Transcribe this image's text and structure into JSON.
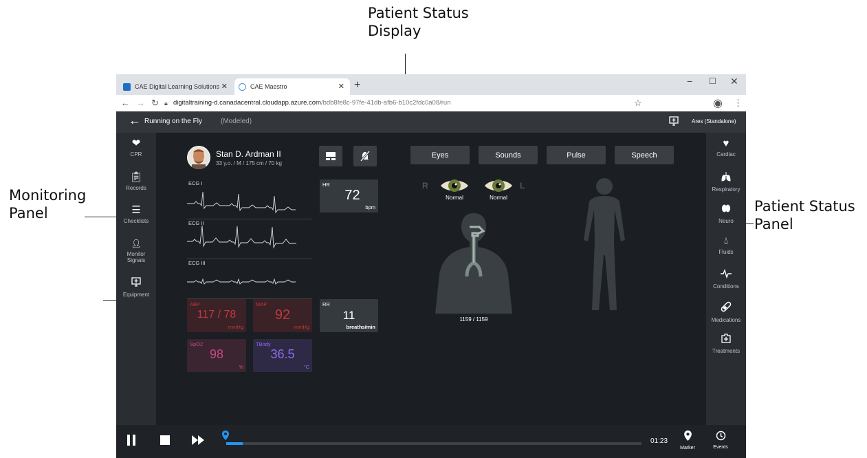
{
  "annotations": {
    "patient_status_display": "Patient Status\nDisplay",
    "monitoring_panel": "Monitoring\nPanel",
    "patient_status_panel": "Patient Status\nPanel"
  },
  "browser": {
    "tabs": [
      {
        "title": "CAE Digital Learning Solutions",
        "icon": "cae-icon"
      },
      {
        "title": "CAE Maestro",
        "icon": "maestro-icon"
      }
    ],
    "url_host": "digitaltraining-d.canadacentral.cloudapp.azure.com",
    "url_path": "/bdb8fe8c-97fe-41db-afb6-b10c2fdc0a08/run"
  },
  "app": {
    "scenario_title": "Running on the Fly",
    "scenario_mode": "(Modeled)",
    "simulator": "Ares (Standalone)"
  },
  "left_nav": [
    {
      "label": "CPR",
      "icon": "heart-pulse-icon"
    },
    {
      "label": "Records",
      "icon": "clipboard-icon"
    },
    {
      "label": "Checklists",
      "icon": "checklist-icon"
    },
    {
      "label": "Monitor\nSignals",
      "icon": "monitor-signals-icon"
    },
    {
      "label": "Equipment",
      "icon": "monitor-icon"
    }
  ],
  "right_nav": [
    {
      "label": "Cardiac",
      "icon": "heart-icon"
    },
    {
      "label": "Respiratory",
      "icon": "lungs-icon"
    },
    {
      "label": "Neuro",
      "icon": "brain-icon"
    },
    {
      "label": "Fluids",
      "icon": "drop-icon"
    },
    {
      "label": "Conditions",
      "icon": "pulse-icon"
    },
    {
      "label": "Medications",
      "icon": "pill-icon"
    },
    {
      "label": "Treatments",
      "icon": "medkit-icon"
    }
  ],
  "patient": {
    "name": "Stan D. Ardman II",
    "details": "33 y.o. / M / 175 cm / 70 kg"
  },
  "ecg": [
    "ECG I",
    "ECG II",
    "ECG III"
  ],
  "vitals": {
    "hr": {
      "label": "HR",
      "value": "72",
      "unit": "bpm"
    },
    "abp": {
      "label": "ABP",
      "value": "117 / 78",
      "unit": "mmHg"
    },
    "map": {
      "label": "MAP",
      "value": "92",
      "unit": "mmHg"
    },
    "rr": {
      "label": "RR",
      "value": "11",
      "unit": "breaths/min"
    },
    "spo2": {
      "label": "SpO2",
      "value": "98",
      "unit": "%"
    },
    "tbody": {
      "label": "TBody",
      "value": "36.5",
      "unit": "°C"
    }
  },
  "status_tabs": [
    "Eyes",
    "Sounds",
    "Pulse",
    "Speech"
  ],
  "eyes": {
    "right_marker": "R",
    "left_marker": "L",
    "right_status": "Normal",
    "left_status": "Normal"
  },
  "airway_counter": "1159 / 1159",
  "playback": {
    "time": "01:23",
    "marker_label": "Marker",
    "events_label": "Events",
    "progress": 0.04
  },
  "colors": {
    "abp": "#c0393f",
    "spo2": "#c54a8a",
    "tbody": "#8f6cf0",
    "progress": "#2196f3"
  }
}
